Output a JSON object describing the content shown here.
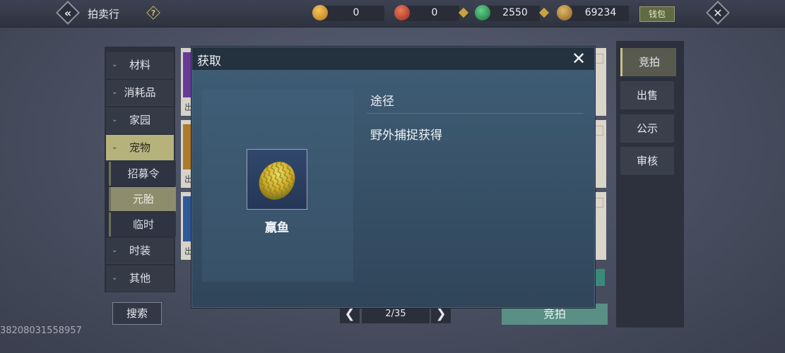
{
  "topbar": {
    "title": "拍卖行",
    "help_glyph": "?",
    "back_glyph": "«",
    "close_glyph": "✕",
    "wallet_label": "钱包",
    "currencies": [
      {
        "name": "gold-pouch-icon",
        "value": "0",
        "color": "#d89a2e"
      },
      {
        "name": "red-coin-icon",
        "value": "0",
        "color": "#c24a3a"
      },
      {
        "name": "jade-coin-icon",
        "value": "2550",
        "color": "#2e9a58"
      },
      {
        "name": "bronze-feather-icon",
        "value": "69234",
        "color": "#b88a3c"
      }
    ]
  },
  "sidebar": {
    "categories": [
      {
        "label": "材料"
      },
      {
        "label": "消耗品"
      },
      {
        "label": "家园"
      },
      {
        "label": "宠物",
        "active": true
      },
      {
        "label": "时装"
      },
      {
        "label": "其他"
      }
    ],
    "subcategories": [
      {
        "label": "招募令"
      },
      {
        "label": "元胎",
        "selected": true
      },
      {
        "label": "临时"
      }
    ],
    "search_label": "搜索"
  },
  "list": {
    "card_label": "出"
  },
  "tabs": [
    {
      "label": "竞拍",
      "active": true
    },
    {
      "label": "出售"
    },
    {
      "label": "公示"
    },
    {
      "label": "审核"
    }
  ],
  "pager": {
    "page": "2/35",
    "prev_glyph": "❮",
    "next_glyph": "❯"
  },
  "bid_button": "竞拍",
  "watermark": "38208031558957",
  "modal": {
    "title": "获取",
    "close_glyph": "✕",
    "item_name": "羸鱼",
    "route_header": "途径",
    "routes": [
      "野外捕捉获得"
    ]
  }
}
